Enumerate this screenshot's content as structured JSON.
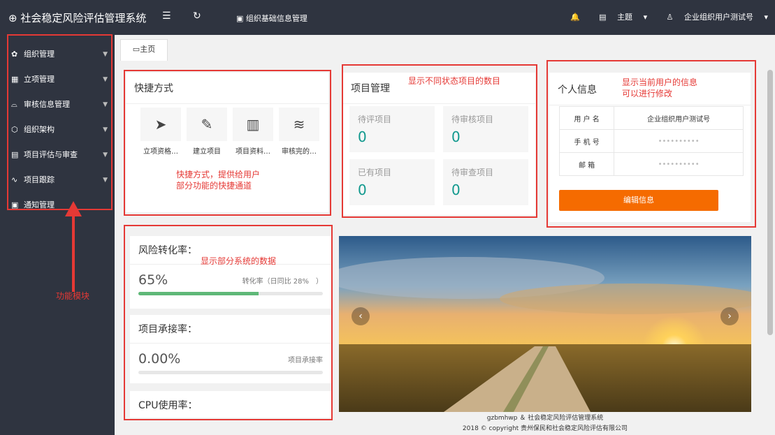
{
  "topbar": {
    "app_title": "社会稳定风险评估管理系统",
    "breadcrumb": "组织基础信息管理",
    "theme_label": "主题",
    "user_label": "企业组织用户测试号"
  },
  "sidebar": {
    "items": [
      {
        "label": "组织管理",
        "icon": "gear-icon"
      },
      {
        "label": "立项管理",
        "icon": "apps-icon"
      },
      {
        "label": "审核信息管理",
        "icon": "book-icon"
      },
      {
        "label": "组织架构",
        "icon": "cube-icon"
      },
      {
        "label": "项目评估与审查",
        "icon": "clipboard-icon"
      },
      {
        "label": "项目跟踪",
        "icon": "pulse-icon"
      },
      {
        "label": "通知管理",
        "icon": "calendar-icon"
      }
    ]
  },
  "tabs": [
    {
      "label": "主页"
    }
  ],
  "quick": {
    "title": "快捷方式",
    "items": [
      {
        "label": "立项资格…",
        "icon": "send-icon"
      },
      {
        "label": "建立项目",
        "icon": "pencil-icon"
      },
      {
        "label": "项目资料…",
        "icon": "document-icon"
      },
      {
        "label": "审核完的…",
        "icon": "layers-icon"
      }
    ]
  },
  "projects": {
    "title": "项目管理",
    "stats": [
      {
        "label": "待评项目",
        "value": "0"
      },
      {
        "label": "待审核项目",
        "value": "0"
      },
      {
        "label": "已有项目",
        "value": "0"
      },
      {
        "label": "待审查项目",
        "value": "0"
      }
    ]
  },
  "profile": {
    "title": "个人信息",
    "rows": [
      {
        "key": "用 户 名",
        "value": "企业组织用户测试号"
      },
      {
        "key": "手 机 号",
        "value": "••••••••••"
      },
      {
        "key": "邮    箱",
        "value": "••••••••••"
      }
    ],
    "edit_label": "编辑信息"
  },
  "metrics": [
    {
      "title": "风险转化率：",
      "value": "65%",
      "note": "转化率（日同比 28%　）",
      "progress": 0.65
    },
    {
      "title": "项目承接率：",
      "value": "0.00%",
      "note": "项目承接率",
      "progress": 0
    },
    {
      "title": "CPU使用率："
    }
  ],
  "annotations": {
    "modules": "功能模块",
    "quick": [
      "快捷方式，提供给用户",
      "部分功能的快捷通道"
    ],
    "projects": "显示不同状态项目的数目",
    "profile": [
      "显示当前用户的信息",
      "可以进行修改"
    ],
    "metrics": "显示部分系统的数据"
  },
  "footer": {
    "line1": "gzbmhwp ＆ 社会稳定风险评估管理系统",
    "line2": "2018 © copyright 贵州保民和社会稳定风险评估有限公司"
  },
  "colors": {
    "dark": "#2f3440",
    "annotation_red": "#e53935",
    "stat_teal": "#11998e",
    "button_orange": "#f56b00",
    "progress_green": "#5fb878"
  }
}
